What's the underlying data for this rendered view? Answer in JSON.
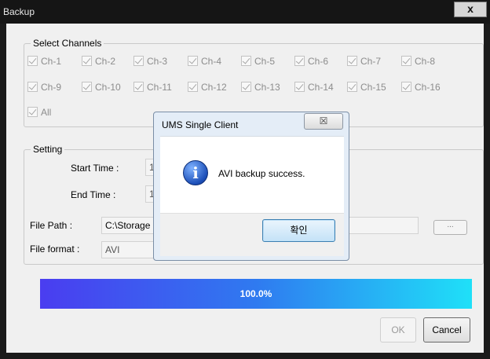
{
  "window": {
    "title": "Backup",
    "close_glyph": "x"
  },
  "channels": {
    "group_title": "Select Channels",
    "items": [
      "Ch-1",
      "Ch-2",
      "Ch-3",
      "Ch-4",
      "Ch-5",
      "Ch-6",
      "Ch-7",
      "Ch-8",
      "Ch-9",
      "Ch-10",
      "Ch-11",
      "Ch-12",
      "Ch-13",
      "Ch-14",
      "Ch-15",
      "Ch-16"
    ],
    "all_label": "All",
    "checked": true
  },
  "setting": {
    "group_title": "Setting",
    "start_time_label": "Start Time :",
    "start_time_value": "1",
    "end_time_label": "End Time :",
    "end_time_value": "1"
  },
  "file": {
    "path_label": "File Path :",
    "path_value": "C:\\Storage",
    "browse_label": "...",
    "format_label": "File format :",
    "format_value": "AVI"
  },
  "progress": {
    "text": "100.0%",
    "value": 1.0,
    "color_start": "#4a3df0",
    "color_end": "#1fe0f8"
  },
  "buttons": {
    "ok_label": "OK",
    "cancel_label": "Cancel"
  },
  "message_box": {
    "title": "UMS Single Client",
    "close_glyph": "☒",
    "icon": "info-icon",
    "icon_glyph": "i",
    "text": "AVI backup success.",
    "confirm_label": "확인"
  }
}
